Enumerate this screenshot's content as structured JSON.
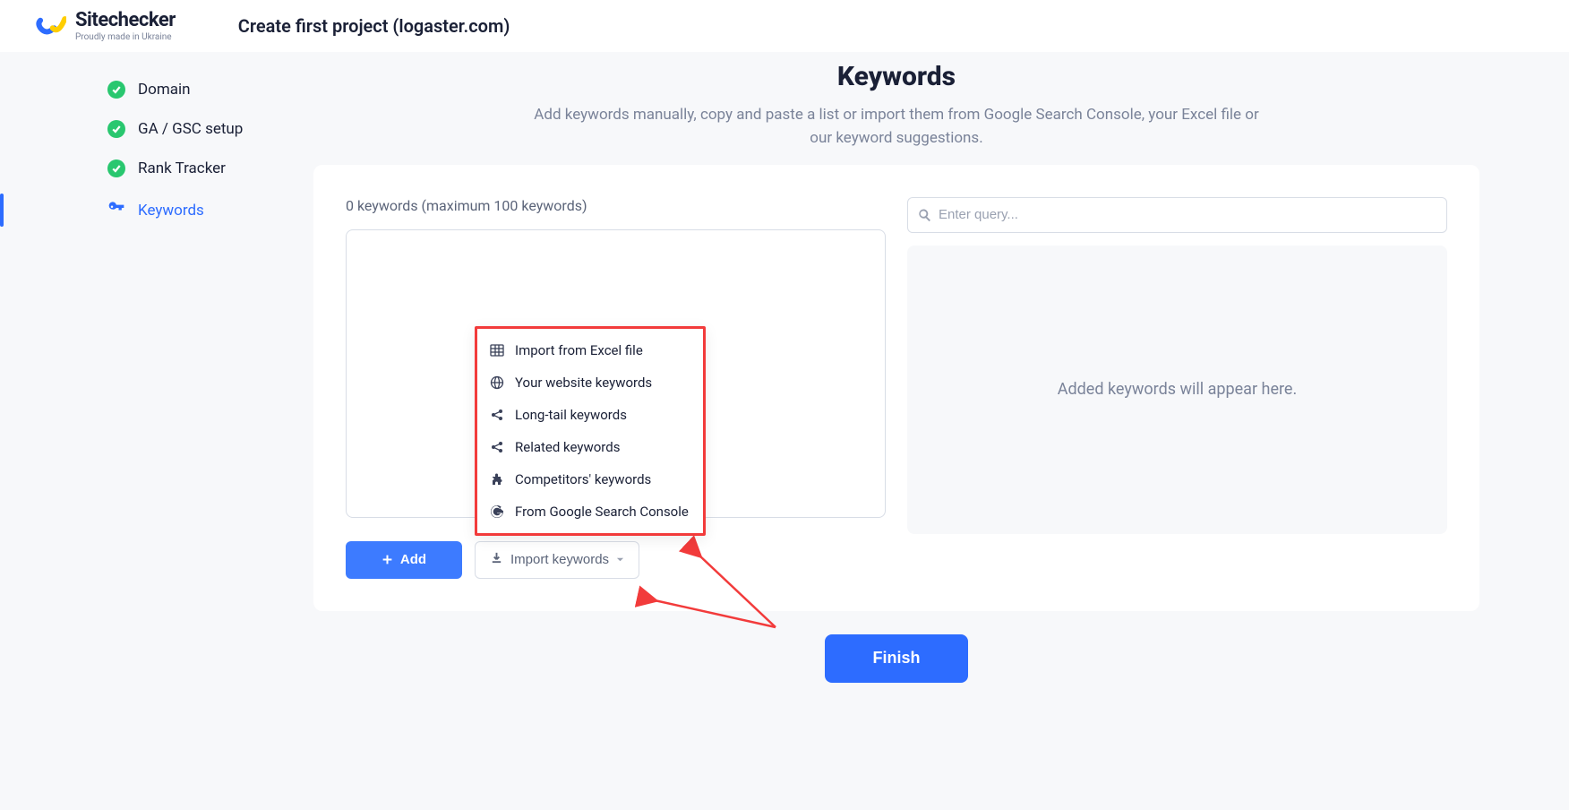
{
  "brand": {
    "name": "Sitechecker",
    "tagline": "Proudly made in Ukraine"
  },
  "project_title": "Create first project (logaster.com)",
  "sidebar": {
    "items": [
      {
        "label": "Domain"
      },
      {
        "label": "GA / GSC setup"
      },
      {
        "label": "Rank Tracker"
      },
      {
        "label": "Keywords"
      }
    ]
  },
  "header": {
    "title": "Keywords",
    "subtitle": "Add keywords manually, copy and paste a list or import them from Google Search Console, your Excel file or our keyword suggestions."
  },
  "left_panel": {
    "count_label": "0 keywords (maximum 100 keywords)",
    "add_button": "Add",
    "import_button": "Import keywords"
  },
  "dropdown": {
    "items": [
      {
        "label": "Import from Excel file"
      },
      {
        "label": "Your website keywords"
      },
      {
        "label": "Long-tail keywords"
      },
      {
        "label": "Related keywords"
      },
      {
        "label": "Competitors' keywords"
      },
      {
        "label": "From Google Search Console"
      }
    ]
  },
  "right_panel": {
    "search_placeholder": "Enter query...",
    "empty_text": "Added keywords will appear here."
  },
  "finish_button": "Finish"
}
